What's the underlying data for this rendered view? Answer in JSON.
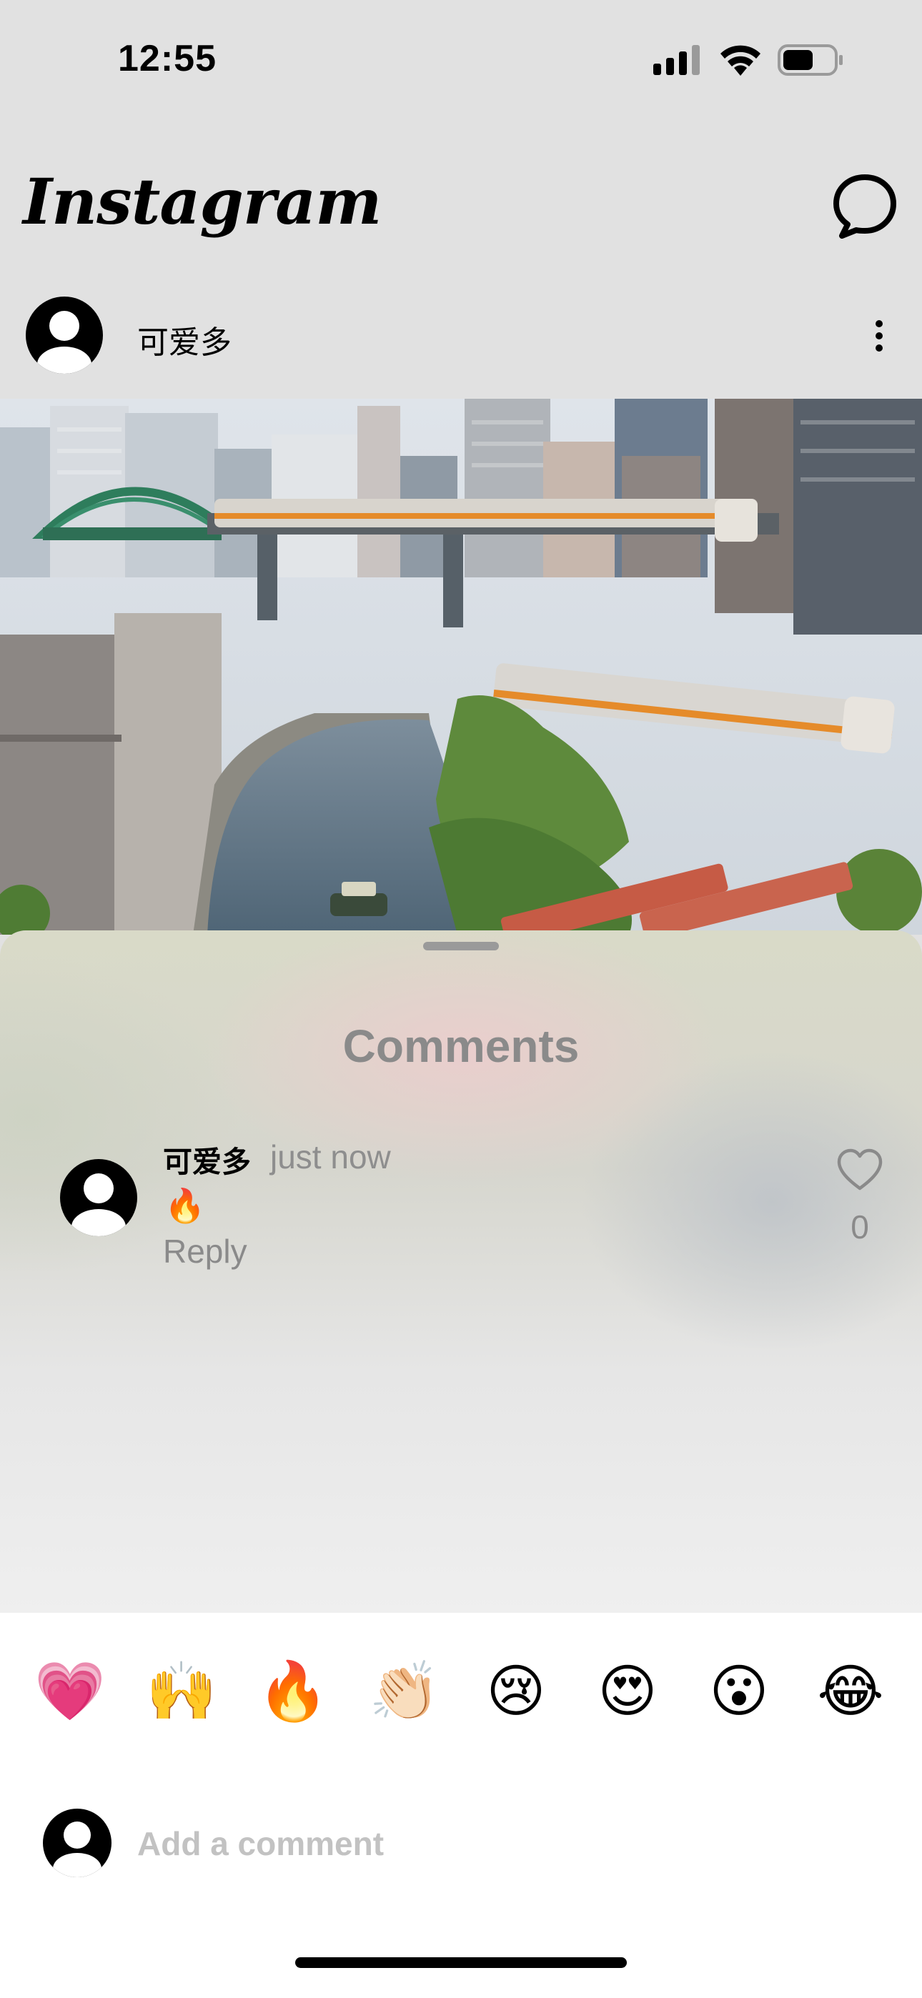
{
  "status_bar": {
    "time": "12:55",
    "icons": [
      "signal-icon",
      "wifi-icon",
      "battery-icon"
    ],
    "battery_level": 0.6
  },
  "header": {
    "app_name": "Instagram",
    "messenger_icon": "messenger-icon"
  },
  "post": {
    "username": "可爱多",
    "more_icon": "more-vertical-icon",
    "image_description_icon": "post-photo"
  },
  "comments_sheet": {
    "title": "Comments",
    "comments": [
      {
        "username": "可爱多",
        "time": "just now",
        "text": "🔥",
        "reply_label": "Reply",
        "like_count": "0"
      }
    ]
  },
  "emoji_bar": [
    "💗",
    "🙌",
    "🔥",
    "👏🏻",
    "😢",
    "😍",
    "😮",
    "😂"
  ],
  "composer": {
    "placeholder": "Add a comment"
  },
  "colors": {
    "background": "#e1e1e1",
    "muted_text": "#8a8a8a",
    "placeholder": "#c2c2c2"
  }
}
